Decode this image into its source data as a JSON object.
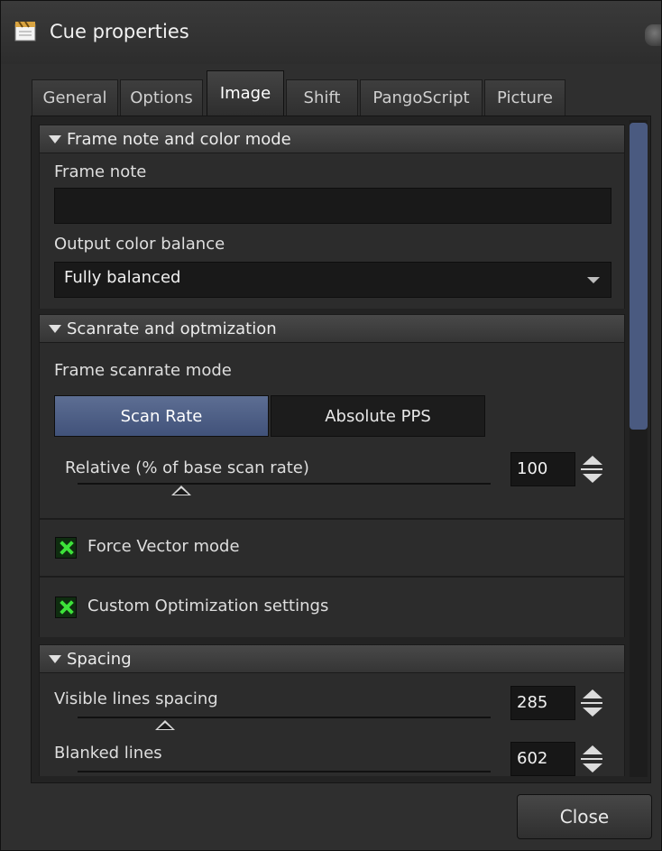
{
  "window": {
    "title": "Cue properties",
    "icon": "cue-icon"
  },
  "tabs": [
    {
      "label": "General"
    },
    {
      "label": "Options"
    },
    {
      "label": "Image",
      "active": true
    },
    {
      "label": "Shift"
    },
    {
      "label": "PangoScript"
    },
    {
      "label": "Picture"
    }
  ],
  "frame_section": {
    "header": "Frame note and color mode",
    "frame_note_label": "Frame note",
    "frame_note_value": "",
    "color_balance_label": "Output color balance",
    "color_balance_value": "Fully balanced"
  },
  "scan_section": {
    "header": "Scanrate and optmization",
    "mode_label": "Frame scanrate mode",
    "mode_options": [
      "Scan Rate",
      "Absolute PPS"
    ],
    "mode_selected": "Scan Rate",
    "relative_label": "Relative (% of base scan rate)",
    "relative_value": "100",
    "force_vector_label": "Force Vector mode",
    "force_vector_checked": true,
    "custom_opt_label": "Custom Optimization settings",
    "custom_opt_checked": true
  },
  "spacing_section": {
    "header": "Spacing",
    "visible_label": "Visible lines spacing",
    "visible_value": "285",
    "blanked_label": "Blanked lines",
    "blanked_value": "602"
  },
  "footer": {
    "close_label": "Close"
  },
  "colors": {
    "accent": "#4a5a80",
    "check": "#3de23a"
  }
}
